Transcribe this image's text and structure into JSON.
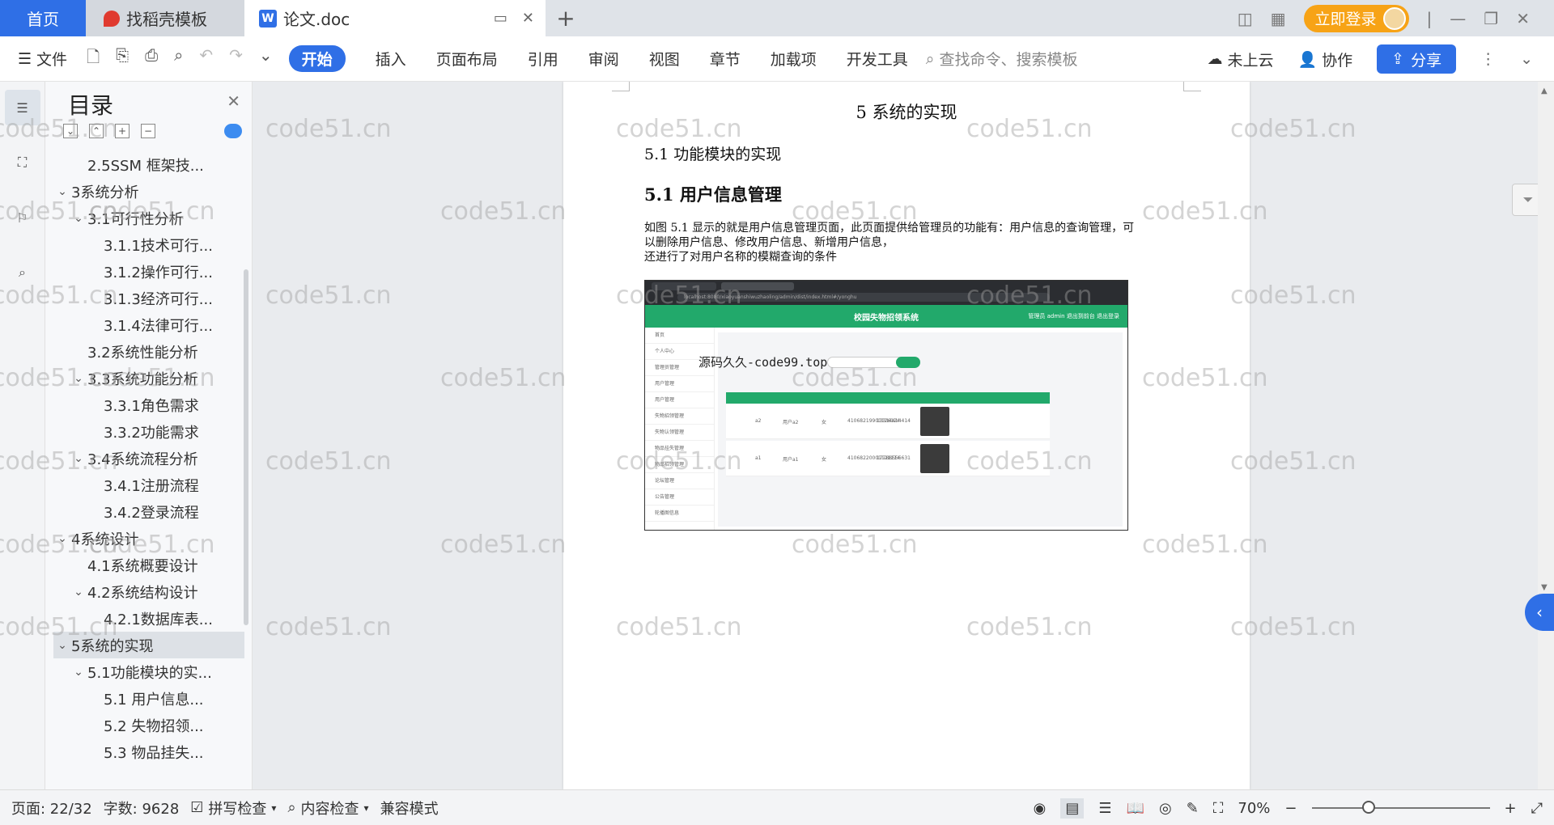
{
  "tabs": {
    "home": "首页",
    "daoke": "找稻壳模板",
    "doc": "论文.doc",
    "new_tab": "+"
  },
  "titlebar": {
    "login": "立即登录"
  },
  "toolbar": {
    "file": "文件",
    "menu_tabs": [
      "开始",
      "插入",
      "页面布局",
      "引用",
      "审阅",
      "视图",
      "章节",
      "加载项",
      "开发工具"
    ],
    "active_tab": "开始",
    "search_placeholder": "查找命令、搜索模板",
    "cloud": "未上云",
    "collab": "协作",
    "share": "分享"
  },
  "toc": {
    "title": "目录",
    "items": [
      {
        "level": 2,
        "label": "2.5SSM 框架技...",
        "chevron": false,
        "selected": false
      },
      {
        "level": 1,
        "label": "3系统分析",
        "chevron": true,
        "selected": false
      },
      {
        "level": 2,
        "label": "3.1可行性分析",
        "chevron": true,
        "selected": false
      },
      {
        "level": 3,
        "label": "3.1.1技术可行...",
        "chevron": false,
        "selected": false
      },
      {
        "level": 3,
        "label": "3.1.2操作可行...",
        "chevron": false,
        "selected": false
      },
      {
        "level": 3,
        "label": "3.1.3经济可行...",
        "chevron": false,
        "selected": false
      },
      {
        "level": 3,
        "label": "3.1.4法律可行...",
        "chevron": false,
        "selected": false
      },
      {
        "level": 2,
        "label": "3.2系统性能分析",
        "chevron": false,
        "selected": false
      },
      {
        "level": 2,
        "label": "3.3系统功能分析",
        "chevron": true,
        "selected": false
      },
      {
        "level": 3,
        "label": "3.3.1角色需求",
        "chevron": false,
        "selected": false
      },
      {
        "level": 3,
        "label": "3.3.2功能需求",
        "chevron": false,
        "selected": false
      },
      {
        "level": 2,
        "label": "3.4系统流程分析",
        "chevron": true,
        "selected": false
      },
      {
        "level": 3,
        "label": "3.4.1注册流程",
        "chevron": false,
        "selected": false
      },
      {
        "level": 3,
        "label": "3.4.2登录流程",
        "chevron": false,
        "selected": false
      },
      {
        "level": 1,
        "label": "4系统设计",
        "chevron": true,
        "selected": false
      },
      {
        "level": 2,
        "label": "4.1系统概要设计",
        "chevron": false,
        "selected": false
      },
      {
        "level": 2,
        "label": "4.2系统结构设计",
        "chevron": true,
        "selected": false
      },
      {
        "level": 3,
        "label": "4.2.1数据库表...",
        "chevron": false,
        "selected": false
      },
      {
        "level": 1,
        "label": "5系统的实现",
        "chevron": true,
        "selected": true
      },
      {
        "level": 2,
        "label": "5.1功能模块的实...",
        "chevron": true,
        "selected": false
      },
      {
        "level": 3,
        "label": "5.1 用户信息...",
        "chevron": false,
        "selected": false
      },
      {
        "level": 3,
        "label": "5.2  失物招领...",
        "chevron": false,
        "selected": false
      },
      {
        "level": 3,
        "label": "5.3 物品挂失...",
        "chevron": false,
        "selected": false
      }
    ]
  },
  "document": {
    "chapter": "5  系统的实现",
    "section": "5.1  功能模块的实现",
    "subsection": "5.1 用户信息管理",
    "paragraph_lines": [
      "如图 5.1 显示的就是用户信息管理页面，此页面提供给管理员的功能有：用户信息的查询管理，可",
      "以删除用户信息、修改用户信息、新增用户信息，",
      "还进行了对用户名称的模糊查询的条件"
    ],
    "screenshot": {
      "url": "localhost:8080/xiaoyuanshiwuzhaoling/admin/dist/index.html#/yonghu",
      "system_title": "校园失物招领系统",
      "header_right": "管理员 admin   退出到前台   退出登录",
      "watermark": "源码久久-code99.top",
      "menu": [
        "首页",
        "个人中心",
        "管理员管理",
        "用户管理",
        "用户管理",
        "失物招领管理",
        "失物认领管理",
        "物品挂失管理",
        "物品招领管理",
        "论坛管理",
        "公告管理",
        "轮播图信息"
      ],
      "rows": [
        {
          "account": "a2",
          "name": "用户a2",
          "gender": "女",
          "id_no": "41068219901126124",
          "phone": "13314414414"
        },
        {
          "account": "a1",
          "name": "用户a1",
          "gender": "女",
          "id_no": "41068220001121114",
          "phone": "17788556631"
        }
      ]
    }
  },
  "watermark_text": "code51.cn",
  "statusbar": {
    "page": "页面: 22/32",
    "words": "字数: 9628",
    "spell": "拼写检查",
    "content": "内容检查",
    "compat": "兼容模式",
    "zoom": "70%",
    "zoom_level": 0.7
  }
}
